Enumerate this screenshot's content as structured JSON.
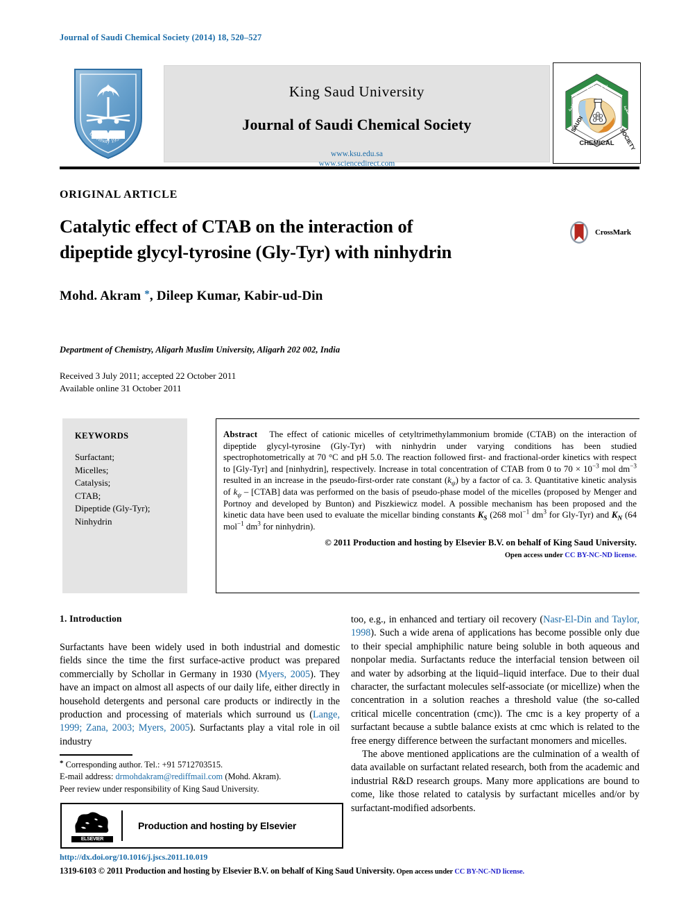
{
  "running_head": "Journal of Saudi Chemical Society (2014) 18, 520–527",
  "masthead": {
    "university": "King Saud University",
    "journal": "Journal of Saudi Chemical Society",
    "url_university": "www.ksu.edu.sa",
    "url_sciencedirect": "www.sciencedirect.com",
    "left_logo_name": "king-saud-university-shield",
    "right_logo_name": "saudi-chemical-society-emblem",
    "right_logo_text_top": "الكيميائية",
    "right_logo_text_left": "السعودية",
    "right_logo_text_right": "الجمعية",
    "right_logo_word_left": "SAUDI",
    "right_logo_word_right": "SOCIETY",
    "right_logo_word_bottom": "CHEMICAL"
  },
  "article": {
    "type": "ORIGINAL ARTICLE",
    "title_line1": "Catalytic effect of CTAB on the interaction of",
    "title_line2": "dipeptide glycyl-tyrosine (Gly-Tyr) with ninhydrin",
    "crossmark_label": "CrossMark",
    "authors": "Mohd. Akram , Dileep Kumar, Kabir-ud-Din",
    "author_star": "*",
    "affiliation": "Department of Chemistry, Aligarh Muslim University, Aligarh 202 002, India",
    "received": "Received 3 July 2011; accepted 22 October 2011",
    "available_online": "Available online 31 October 2011"
  },
  "keywords": {
    "heading": "KEYWORDS",
    "items": [
      "Surfactant;",
      "Micelles;",
      "Catalysis;",
      "CTAB;",
      "Dipeptide (Gly-Tyr);",
      "Ninhydrin"
    ]
  },
  "abstract": {
    "label": "Abstract",
    "text_part1": "The effect of cationic micelles of cetyltrimethylammonium bromide (CTAB) on the interaction of dipeptide glycyl-tyrosine (Gly-Tyr) with ninhydrin under varying conditions has been studied spectrophotometrically at 70 °C and pH 5.0. The reaction followed first- and fractional-order kinetics with respect to [Gly-Tyr] and [ninhydrin], respectively. Increase in total concentration of CTAB from 0 to 70 × 10",
    "exp_neg3_a": "−3",
    "text_part2": " mol dm",
    "exp_neg3_b": "−3",
    "text_part3": " resulted in an increase in the pseudo-first-order rate constant (",
    "k_psi": "kψ",
    "text_part4": ") by a factor of ca. 3. Quantitative kinetic analysis of ",
    "k_psi_2": "kψ",
    "text_part5": " – [CTAB] data was performed on the basis of pseudo-phase model of the micelles (proposed by Menger and Portnoy and developed by Bunton) and Piszkiewicz model. A possible mechanism has been proposed and the kinetic data have been used to evaluate the micellar binding constants ",
    "K_S": "KS",
    "text_part6": " (268 mol",
    "exp_neg1_a": "−1",
    "text_part7": " dm",
    "exp_3_a": "3",
    "text_part8": " for Gly-Tyr) and ",
    "K_N": "KN",
    "text_part9": " (64 mol",
    "exp_neg1_b": "−1",
    "text_part10": " dm",
    "exp_3_b": "3",
    "text_part11": " for ninhydrin).",
    "copyright": "© 2011 Production and hosting by Elsevier B.V. on behalf of King Saud University.",
    "open_access_prefix": "Open access under ",
    "open_access_link": "CC BY-NC-ND license."
  },
  "introduction": {
    "heading": "1. Introduction",
    "left_p1_a": "Surfactants have been widely used in both industrial and domestic fields since the time the first surface-active product was prepared commercially by Schollar in Germany in 1930 (",
    "left_p1_ref1": "Myers, 2005",
    "left_p1_b": "). They have an impact on almost all aspects of our daily life, either directly in household detergents and personal care products or indirectly in the production and processing of materials which surround us (",
    "left_p1_ref2": "Lange, 1999; Zana, 2003; Myers, 2005",
    "left_p1_c": "). Surfactants play a vital role in oil industry",
    "right_p1_a": "too, e.g., in enhanced and tertiary oil recovery (",
    "right_p1_ref1": "Nasr-El-Din and Taylor, 1998",
    "right_p1_b": "). Such a wide arena of applications has become possible only due to their special amphiphilic nature being soluble in both aqueous and nonpolar media. Surfactants reduce the interfacial tension between oil and water by adsorbing at the liquid–liquid interface. Due to their dual character, the surfactant molecules self-associate (or micellize) when the concentration in a solution reaches a threshold value (the so-called critical micelle concentration (cmc)). The cmc is a key property of a surfactant because a subtle balance exists at cmc which is related to the free energy difference between the surfactant monomers and micelles.",
    "right_p2": "The above mentioned applications are the culmination of a wealth of data available on surfactant related research, both from the academic and industrial R&D research groups. Many more applications are bound to come, like those related to catalysis by surfactant micelles and/or by surfactant-modified adsorbents."
  },
  "footnote": {
    "star": "*",
    "corresponding": "Corresponding author. Tel.: +91 5712703515.",
    "email_label": "E-mail address:",
    "email": "drmohdakram@rediffmail.com",
    "email_suffix": "(Mohd. Akram).",
    "peer_review": "Peer review under responsibility of King Saud University."
  },
  "elsevier_box": {
    "logo_word": "ELSEVIER",
    "text": "Production and hosting by Elsevier"
  },
  "footer": {
    "doi": "http://dx.doi.org/10.1016/j.jscs.2011.10.019",
    "issn_main": "1319-6103 © 2011 Production and hosting by Elsevier B.V. on behalf of King Saud University.",
    "open_access_prefix": " Open access under ",
    "open_access_link": "CC BY-NC-ND license."
  },
  "colors": {
    "journal_blue": "#1b6ca8",
    "link_blue": "#2222cc",
    "masthead_grey": "#e2e2e2",
    "keywords_grey": "#e4e4e4",
    "crossmark_red": "#b5261e",
    "scs_green": "#2f8a45",
    "scs_orange": "#e08a2a"
  }
}
